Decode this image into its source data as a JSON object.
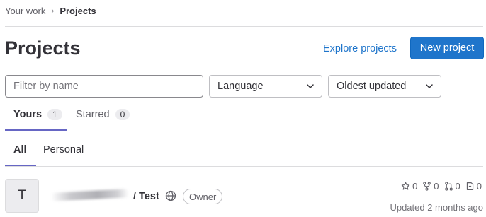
{
  "breadcrumb": {
    "parent": "Your work",
    "separator": "›",
    "current": "Projects"
  },
  "header": {
    "title": "Projects",
    "explore_label": "Explore projects",
    "new_project_label": "New project"
  },
  "filters": {
    "name_placeholder": "Filter by name",
    "language_label": "Language",
    "sort_label": "Oldest updated"
  },
  "tabs": [
    {
      "label": "Yours",
      "count": "1",
      "active": true
    },
    {
      "label": "Starred",
      "count": "0",
      "active": false
    }
  ],
  "subtabs": [
    {
      "label": "All",
      "active": true
    },
    {
      "label": "Personal",
      "active": false
    }
  ],
  "project": {
    "avatar_letter": "T",
    "name": "/ Test",
    "visibility_icon": "globe-icon",
    "role": "Owner",
    "stars": "0",
    "forks": "0",
    "merge_requests": "0",
    "issues": "0",
    "updated": "Updated 2 months ago"
  },
  "colors": {
    "primary": "#1f75cb",
    "tab_underline": "#6666c4"
  }
}
